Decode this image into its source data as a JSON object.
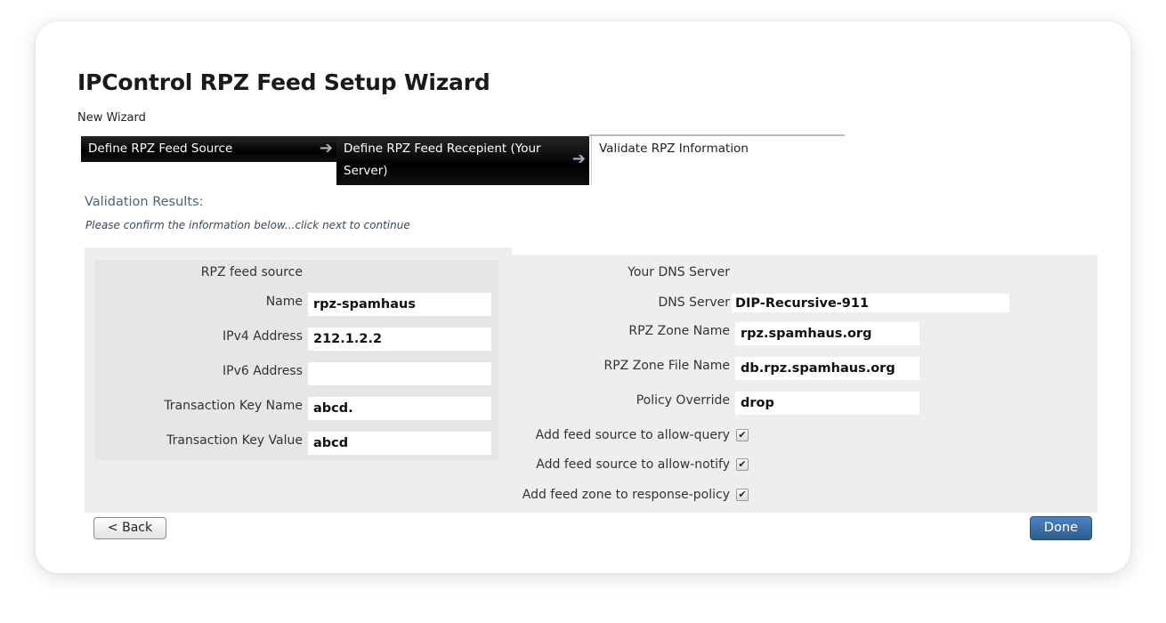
{
  "page_title": "IPControl RPZ Feed Setup Wizard",
  "wizard_subtitle": "New Wizard",
  "steps": [
    {
      "label": "Define RPZ Feed Source"
    },
    {
      "label": "Define RPZ Feed Recepient (Your Server)"
    },
    {
      "label": "Validate RPZ Information"
    }
  ],
  "validation": {
    "title": "Validation Results:",
    "hint": "Please confirm the information below...click next to continue"
  },
  "source": {
    "heading": "RPZ feed source",
    "fields": [
      {
        "label": "Name",
        "value": "rpz-spamhaus"
      },
      {
        "label": "IPv4 Address",
        "value": "212.1.2.2"
      },
      {
        "label": "IPv6 Address",
        "value": ""
      },
      {
        "label": "Transaction Key Name",
        "value": "abcd."
      },
      {
        "label": "Transaction Key Value",
        "value": "abcd"
      }
    ]
  },
  "server": {
    "heading": "Your DNS Server",
    "fields": [
      {
        "label": "DNS Server",
        "value": "DIP-Recursive-911"
      },
      {
        "label": "RPZ Zone Name",
        "value": "rpz.spamhaus.org"
      },
      {
        "label": "RPZ Zone File Name",
        "value": "db.rpz.spamhaus.org"
      },
      {
        "label": "Policy Override",
        "value": "drop"
      }
    ],
    "checks": [
      {
        "label": "Add feed source to allow-query",
        "mark": "✔"
      },
      {
        "label": "Add feed source to allow-notify",
        "mark": "✔"
      },
      {
        "label": "Add feed zone to response-policy",
        "mark": "✔"
      }
    ]
  },
  "buttons": {
    "back": "< Back",
    "done": "Done"
  }
}
